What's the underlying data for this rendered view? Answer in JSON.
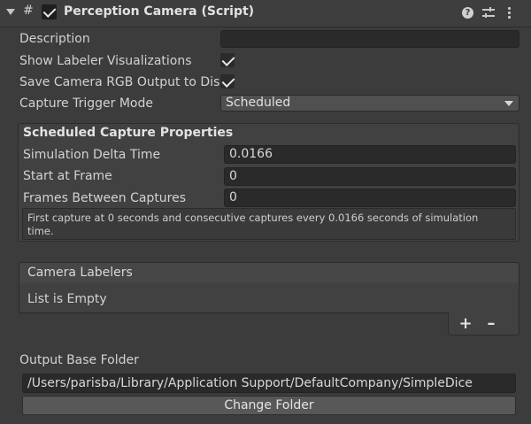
{
  "header": {
    "title": "Perception Camera (Script)",
    "hash_glyph": "#",
    "help_glyph": "?",
    "enabled": true,
    "icons": [
      "foldout-triangle-icon",
      "script-icon",
      "help-icon",
      "presets-icon",
      "kebab-menu-icon"
    ]
  },
  "properties": {
    "description_label": "Description",
    "description_value": "",
    "show_visualizations_label": "Show Labeler Visualizations",
    "show_visualizations_checked": true,
    "save_rgb_label": "Save Camera RGB Output to Disk",
    "save_rgb_checked": true,
    "capture_mode_label": "Capture Trigger Mode",
    "capture_mode_value": "Scheduled"
  },
  "scheduled": {
    "title": "Scheduled Capture Properties",
    "delta_label": "Simulation Delta Time",
    "delta_value": "0.0166",
    "start_label": "Start at Frame",
    "start_value": "0",
    "between_label": "Frames Between Captures",
    "between_value": "0",
    "info_line1": "First capture at 0 seconds and consecutive captures every 0.0166 seconds of simulation",
    "info_line2": "time."
  },
  "labelers": {
    "title": "Camera Labelers",
    "empty_text": "List is Empty",
    "add_glyph": "+",
    "remove_glyph": "–"
  },
  "output": {
    "label": "Output Base Folder",
    "path": "/Users/parisba/Library/Application Support/DefaultCompany/SimpleDice",
    "change_button": "Change Folder"
  },
  "colors": {
    "background": "#3c3c3c",
    "field": "#2a2a2a",
    "text": "#d2d2d2"
  }
}
